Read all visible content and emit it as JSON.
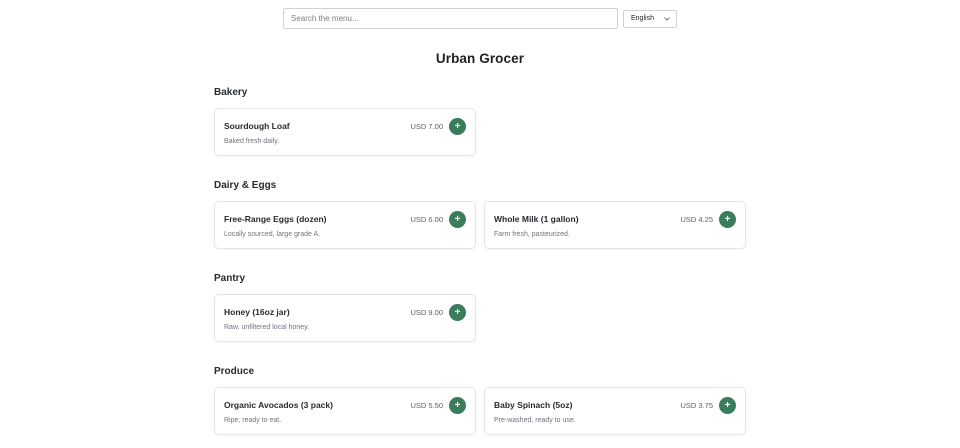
{
  "search": {
    "placeholder": "Search the menu..."
  },
  "language": {
    "selected": "English"
  },
  "store": {
    "title": "Urban Grocer"
  },
  "sections": [
    {
      "title": "Bakery",
      "items": [
        {
          "name": "Sourdough Loaf",
          "description": "Baked fresh daily.",
          "price": "USD 7.00",
          "add_label": "+"
        }
      ]
    },
    {
      "title": "Dairy & Eggs",
      "items": [
        {
          "name": "Free-Range Eggs (dozen)",
          "description": "Locally sourced, large grade A.",
          "price": "USD 6.00",
          "add_label": "+"
        },
        {
          "name": "Whole Milk (1 gallon)",
          "description": "Farm fresh, pasteurized.",
          "price": "USD 4.25",
          "add_label": "+"
        }
      ]
    },
    {
      "title": "Pantry",
      "items": [
        {
          "name": "Honey (16oz jar)",
          "description": "Raw, unfiltered local honey.",
          "price": "USD 9.00",
          "add_label": "+"
        }
      ]
    },
    {
      "title": "Produce",
      "items": [
        {
          "name": "Organic Avocados (3 pack)",
          "description": "Ripe, ready to eat.",
          "price": "USD 5.50",
          "add_label": "+"
        },
        {
          "name": "Baby Spinach (5oz)",
          "description": "Pre-washed, ready to use.",
          "price": "USD 3.75",
          "add_label": "+"
        }
      ]
    }
  ],
  "icons": {
    "language_dropdown": "chevron-down-icon"
  },
  "colors": {
    "accent": "#3a7d5a",
    "border": "#e2e5e9",
    "muted_text": "#6f757c"
  }
}
